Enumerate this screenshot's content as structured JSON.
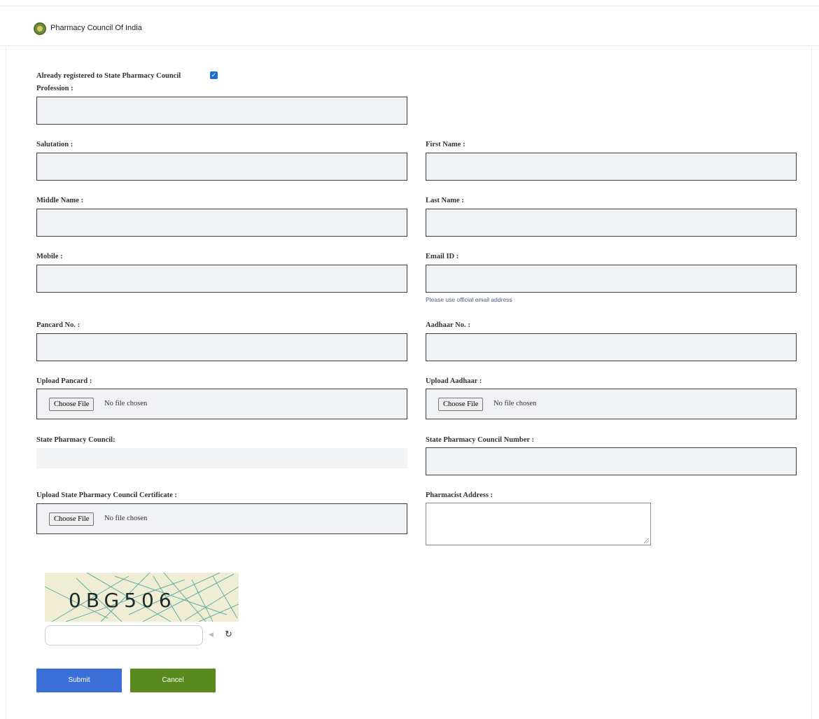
{
  "header": {
    "brand": "Pharmacy Council Of India"
  },
  "form": {
    "already_registered_label": "Already registered to State Pharmacy Council",
    "already_registered_checked": true,
    "profession_label": "Profession :",
    "salutation_label": "Salutation :",
    "first_name_label": "First Name :",
    "middle_name_label": "Middle Name :",
    "last_name_label": "Last Name :",
    "mobile_label": "Mobile :",
    "email_label": "Email ID :",
    "email_hint": "Please use official email address",
    "pancard_label": "Pancard No. :",
    "aadhaar_label": "Aadhaar No. :",
    "upload_pancard_label": "Upload Pancard :",
    "upload_aadhaar_label": "Upload Aadhaar :",
    "state_council_label": "State Pharmacy Council:",
    "state_council_number_label": "State Pharmacy Council Number :",
    "upload_certificate_label": "Upload State Pharmacy Council Certificate :",
    "address_label": "Pharmacist Address :",
    "choose_file": "Choose File",
    "no_file": "No file chosen"
  },
  "captcha": {
    "text": "0BG506",
    "input_value": ""
  },
  "buttons": {
    "submit": "Submit",
    "cancel": "Cancel"
  },
  "colors": {
    "submit_bg": "#3a6fd8",
    "cancel_bg": "#5a8a1e",
    "field_bg": "#f1f2f5",
    "checkbox": "#1f6fd1"
  }
}
